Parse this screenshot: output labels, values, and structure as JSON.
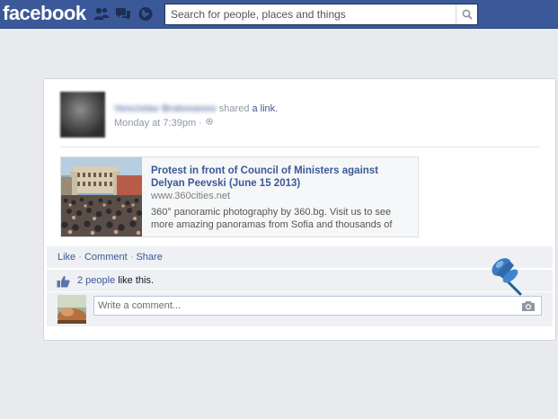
{
  "topbar": {
    "logo": "facebook",
    "search_placeholder": "Search for people, places and things",
    "icons": [
      "friends-icon",
      "messages-icon",
      "notifications-icon",
      "search-icon"
    ]
  },
  "post": {
    "author": "Vencislav Bratovanov",
    "action": "shared",
    "object": "a link.",
    "timestamp": "Monday at 7:39pm",
    "separator": "·",
    "audience_icon": "gear-icon"
  },
  "link_preview": {
    "title": "Protest in front of Council of Ministers against Delyan Peevski (June 15 2013)",
    "domain": "www.360cities.net",
    "description": "360° panoramic photography by 360.bg. Visit us to see more amazing panoramas from Sofia and thousands of"
  },
  "actions": {
    "like": "Like",
    "comment": "Comment",
    "share": "Share",
    "dot": "·"
  },
  "likes": {
    "count_text": "2 people",
    "suffix": "like this."
  },
  "comment_box": {
    "placeholder": "Write a comment..."
  },
  "colors": {
    "brand": "#3b5998",
    "background": "#e9eaed",
    "bar": "#eef0f4",
    "pin": "#3a7cc2"
  }
}
